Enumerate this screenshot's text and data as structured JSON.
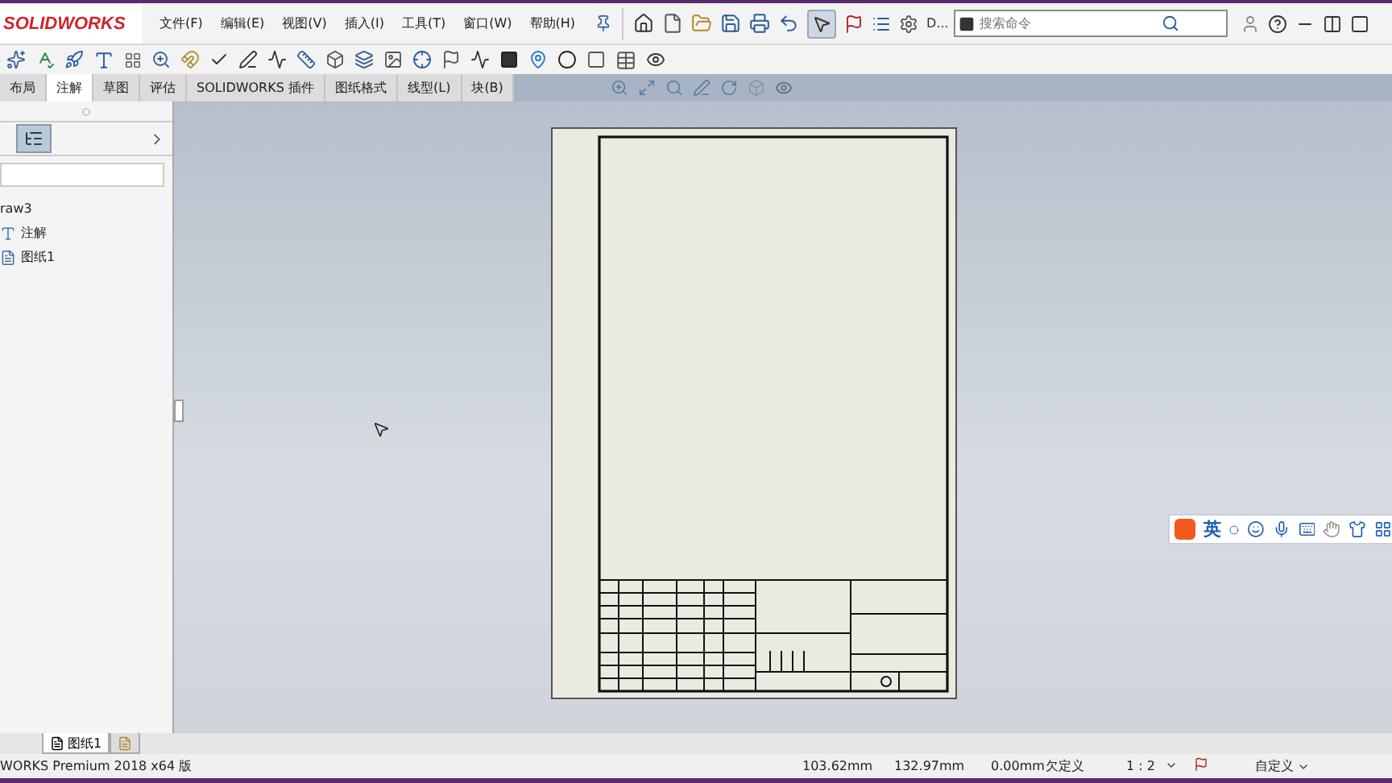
{
  "titlebar": {
    "logo": "SOLIDWORKS"
  },
  "menu": [
    {
      "label": "文件(F)"
    },
    {
      "label": "编辑(E)"
    },
    {
      "label": "视图(V)"
    },
    {
      "label": "插入(I)"
    },
    {
      "label": "工具(T)"
    },
    {
      "label": "窗口(W)"
    },
    {
      "label": "帮助(H)"
    }
  ],
  "quick_toolbar": {
    "overflow_label": "D..."
  },
  "search": {
    "placeholder": "搜索命令"
  },
  "ribbon_tabs": [
    {
      "label": "布局",
      "selected": false
    },
    {
      "label": "注解",
      "selected": true
    },
    {
      "label": "草图",
      "selected": false
    },
    {
      "label": "评估",
      "selected": false
    },
    {
      "label": "SOLIDWORKS 插件",
      "selected": false
    },
    {
      "label": "图纸格式",
      "selected": false
    },
    {
      "label": "线型(L)",
      "selected": false
    },
    {
      "label": "块(B)",
      "selected": false
    }
  ],
  "tree": [
    {
      "label": "raw3",
      "children": [
        {
          "label": "注解",
          "kind": "annotation"
        },
        {
          "label": "图纸1",
          "kind": "sheet"
        }
      ]
    }
  ],
  "sheet_tabs": [
    {
      "label": "图纸1",
      "selected": true
    }
  ],
  "status_bar": {
    "product": "WORKS Premium 2018 x64 版",
    "x": "103.62mm",
    "y": "132.97mm",
    "z": "0.00mm",
    "state": "欠定义",
    "scale": "1 : 2",
    "units": "自定义"
  },
  "ime": {
    "mode": "英"
  }
}
